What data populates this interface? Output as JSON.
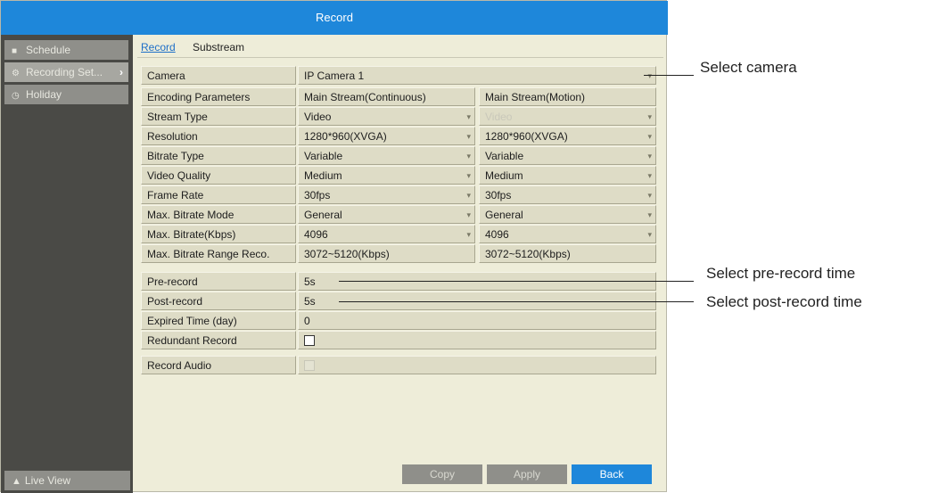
{
  "window": {
    "title": "Record"
  },
  "sidebar": {
    "items": [
      {
        "label": "Schedule",
        "icon": "square-icon"
      },
      {
        "label": "Recording Set...",
        "icon": "gear-icon",
        "active": true
      },
      {
        "label": "Holiday",
        "icon": "clock-icon"
      }
    ],
    "live_view": "Live View"
  },
  "tabs": [
    {
      "label": "Record",
      "active": true
    },
    {
      "label": "Substream"
    }
  ],
  "camera": {
    "label": "Camera",
    "value": "IP Camera 1"
  },
  "encoding": {
    "header": {
      "label": "Encoding Parameters",
      "col1": "Main Stream(Continuous)",
      "col2": "Main Stream(Motion)"
    },
    "rows": [
      {
        "label": "Stream Type",
        "v1": "Video",
        "v2": "Video",
        "v2_disabled": true
      },
      {
        "label": "Resolution",
        "v1": "1280*960(XVGA)",
        "v2": "1280*960(XVGA)"
      },
      {
        "label": "Bitrate Type",
        "v1": "Variable",
        "v2": "Variable"
      },
      {
        "label": "Video Quality",
        "v1": "Medium",
        "v2": "Medium"
      },
      {
        "label": "Frame Rate",
        "v1": "30fps",
        "v2": "30fps"
      },
      {
        "label": "Max. Bitrate Mode",
        "v1": "General",
        "v2": "General"
      },
      {
        "label": "Max. Bitrate(Kbps)",
        "v1": "4096",
        "v2": "4096"
      },
      {
        "label": "Max. Bitrate Range Reco.",
        "v1": "3072~5120(Kbps)",
        "v2": "3072~5120(Kbps)"
      }
    ]
  },
  "options": {
    "pre_record": {
      "label": "Pre-record",
      "value": "5s"
    },
    "post_record": {
      "label": "Post-record",
      "value": "5s"
    },
    "expired": {
      "label": "Expired Time (day)",
      "value": "0"
    },
    "redundant": {
      "label": "Redundant Record",
      "checked": false
    },
    "audio": {
      "label": "Record Audio",
      "checked": false,
      "disabled": true
    }
  },
  "buttons": {
    "copy": "Copy",
    "apply": "Apply",
    "back": "Back"
  },
  "callouts": {
    "camera": "Select camera",
    "pre": "Select pre-record time",
    "post": "Select post-record time"
  },
  "colors": {
    "accent": "#1e87da",
    "panel": "#eeedd9",
    "sidebar": "#4a4a46"
  }
}
